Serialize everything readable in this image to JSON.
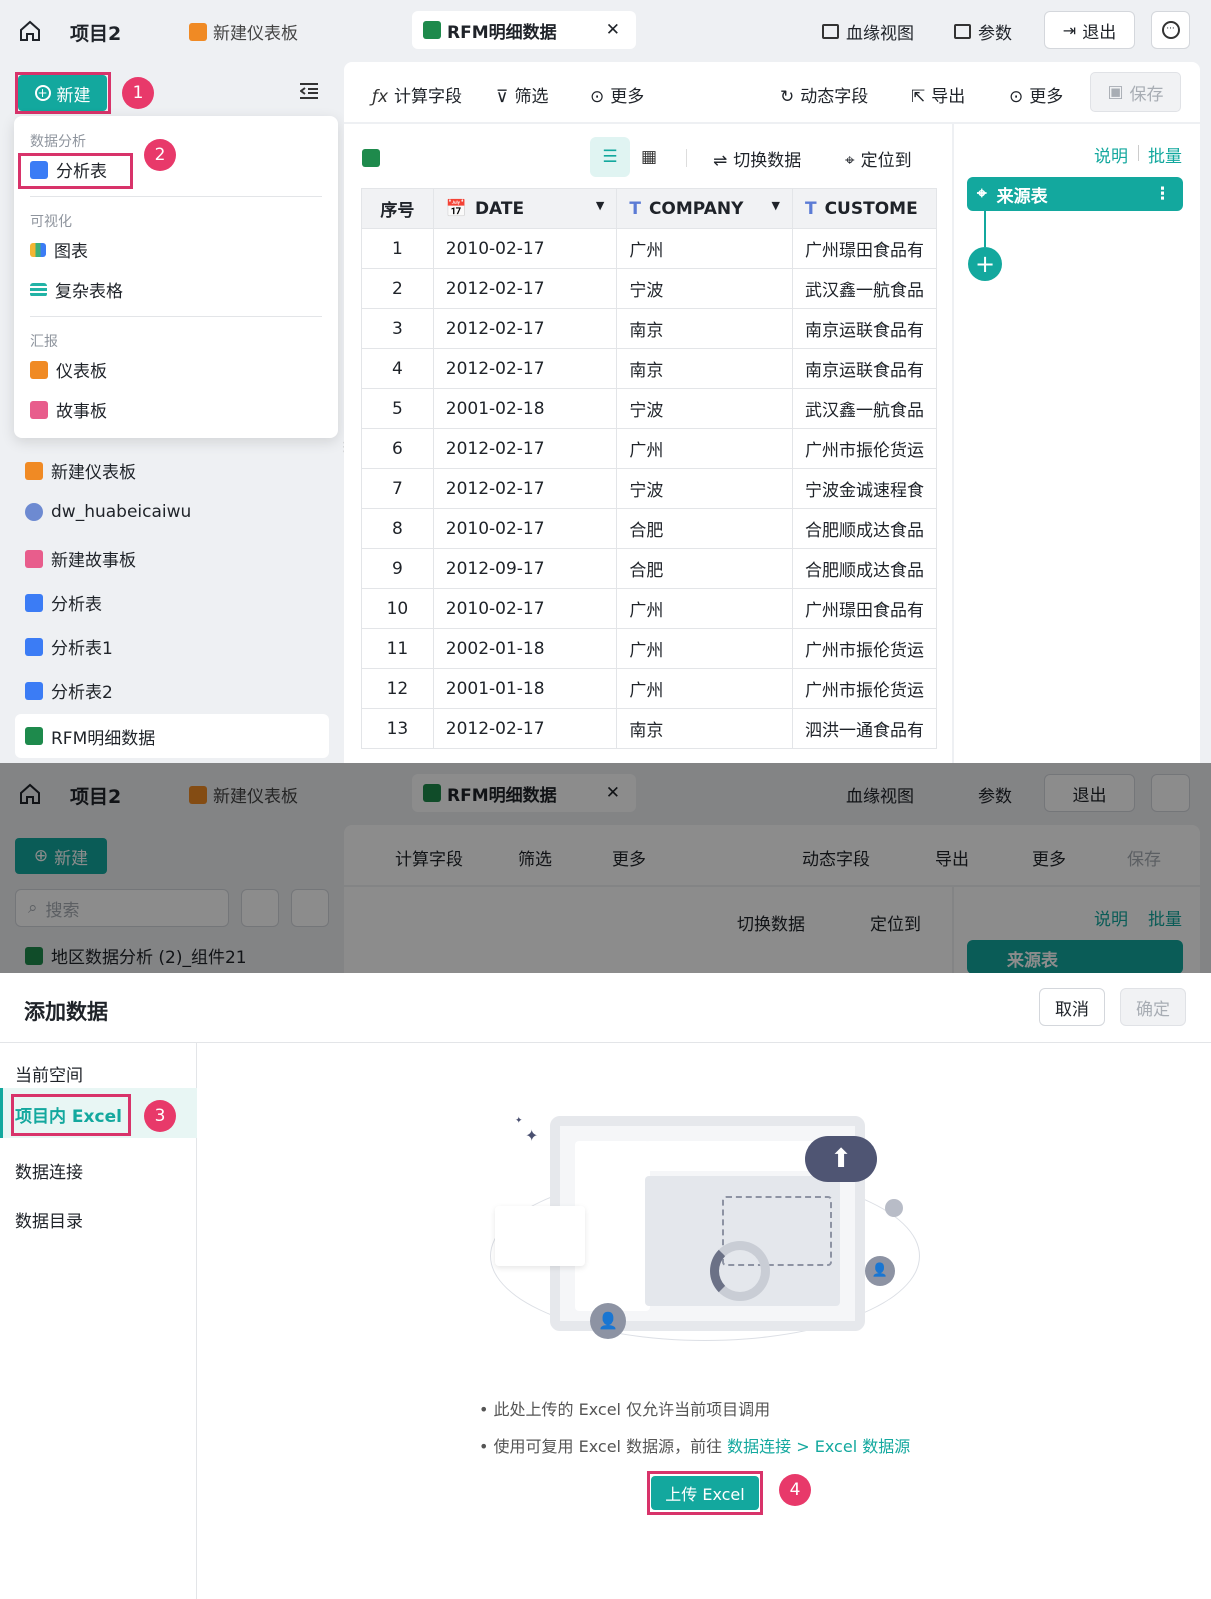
{
  "top": {
    "project": "项目2",
    "tab_dashboard": "新建仪表板",
    "tab_active": "RFM明细数据",
    "close": "✕",
    "lineage": "血缘视图",
    "params": "参数",
    "exit": "退出"
  },
  "sidebar": {
    "new_button": "新建",
    "search_placeholder": "搜索",
    "items": [
      {
        "label": "新建仪表板",
        "icon": "dashboard-icon"
      },
      {
        "label": "dw_huabeicaiwu",
        "icon": "database-icon"
      },
      {
        "label": "新建故事板",
        "icon": "story-icon"
      },
      {
        "label": "分析表",
        "icon": "analysis-icon"
      },
      {
        "label": "分析表1",
        "icon": "analysis-icon"
      },
      {
        "label": "分析表2",
        "icon": "analysis-icon"
      },
      {
        "label": "RFM明细数据",
        "icon": "excel-icon"
      }
    ],
    "overlay_item": "地区数据分析 (2)_组件21"
  },
  "dropdown": {
    "section1": "数据分析",
    "item_analysis": "分析表",
    "section2": "可视化",
    "item_chart": "图表",
    "item_complex": "复杂表格",
    "section3": "汇报",
    "item_dashboard": "仪表板",
    "item_story": "故事板"
  },
  "toolbar": {
    "calc": "计算字段",
    "filter": "筛选",
    "more1": "更多",
    "dynamic": "动态字段",
    "export": "导出",
    "more2": "更多",
    "save": "保存"
  },
  "subtoolbar": {
    "switch": "切换数据",
    "locate": "定位到"
  },
  "table": {
    "headers": [
      "序号",
      "DATE",
      "COMPANY",
      "CUSTOME"
    ],
    "rows": [
      [
        "1",
        "2010-02-17",
        "广州",
        "广州璟田食品有"
      ],
      [
        "2",
        "2012-02-17",
        "宁波",
        "武汉鑫一航食品"
      ],
      [
        "3",
        "2012-02-17",
        "南京",
        "南京运联食品有"
      ],
      [
        "4",
        "2012-02-17",
        "南京",
        "南京运联食品有"
      ],
      [
        "5",
        "2001-02-18",
        "宁波",
        "武汉鑫一航食品"
      ],
      [
        "6",
        "2012-02-17",
        "广州",
        "广州市振伦货运"
      ],
      [
        "7",
        "2012-02-17",
        "宁波",
        "宁波金诚速程食"
      ],
      [
        "8",
        "2010-02-17",
        "合肥",
        "合肥顺成达食品"
      ],
      [
        "9",
        "2012-09-17",
        "合肥",
        "合肥顺成达食品"
      ],
      [
        "10",
        "2010-02-17",
        "广州",
        "广州璟田食品有"
      ],
      [
        "11",
        "2002-01-18",
        "广州",
        "广州市振伦货运"
      ],
      [
        "12",
        "2001-01-18",
        "广州",
        "广州市振伦货运"
      ],
      [
        "13",
        "2012-02-17",
        "南京",
        "泗洪一通食品有"
      ]
    ]
  },
  "right_panel": {
    "explain": "说明",
    "batch": "批量",
    "source": "来源表"
  },
  "dialog": {
    "title": "添加数据",
    "cancel": "取消",
    "confirm": "确定",
    "nav": [
      "当前空间",
      "项目内 Excel",
      "数据连接",
      "数据目录"
    ],
    "note1": "• 此处上传的 Excel 仅允许当前项目调用",
    "note2_prefix": "• 使用可复用 Excel 数据源，前往 ",
    "note2_link": "数据连接 > Excel 数据源",
    "upload": "上传 Excel"
  },
  "badges": [
    "1",
    "2",
    "3",
    "4"
  ],
  "colors": {
    "accent": "#13a89e",
    "highlight": "#d8336a"
  }
}
